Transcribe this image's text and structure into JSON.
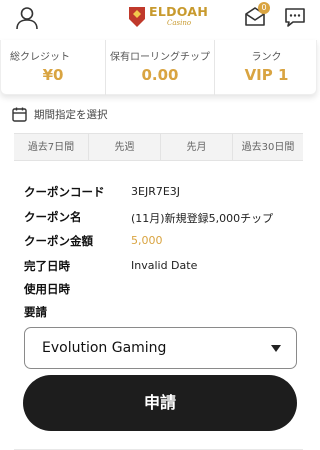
{
  "header": {
    "logo_text": "ELDOAH",
    "logo_sub": "Casino",
    "mail_badge": "0",
    "icons": [
      "user-icon",
      "mail-icon",
      "chat-icon"
    ]
  },
  "stats": [
    {
      "label": "総クレジット",
      "value": "¥0"
    },
    {
      "label": "保有ローリングチップ",
      "value": "0.00"
    },
    {
      "label": "ランク",
      "value": "VIP 1"
    }
  ],
  "period": {
    "label": "期間指定を選択",
    "icon": "calendar-icon"
  },
  "tabs": [
    "過去7日間",
    "先週",
    "先月",
    "過去30日間"
  ],
  "details": [
    {
      "label": "クーポンコード",
      "value": "3EJR7E3J"
    },
    {
      "label": "クーポン名",
      "value": "(11月)新規登録5,000チップ"
    },
    {
      "label": "クーポン金額",
      "value": "5,000"
    },
    {
      "label": "完了日時",
      "value": "Invalid Date"
    },
    {
      "label": "使用日時",
      "value": ""
    },
    {
      "label": "要請",
      "value": ""
    }
  ],
  "select": {
    "value": "Evolution Gaming"
  },
  "apply_button": {
    "label": "申請"
  },
  "colors": {
    "accent": "#d9a441",
    "button": "#1d1d1d"
  }
}
